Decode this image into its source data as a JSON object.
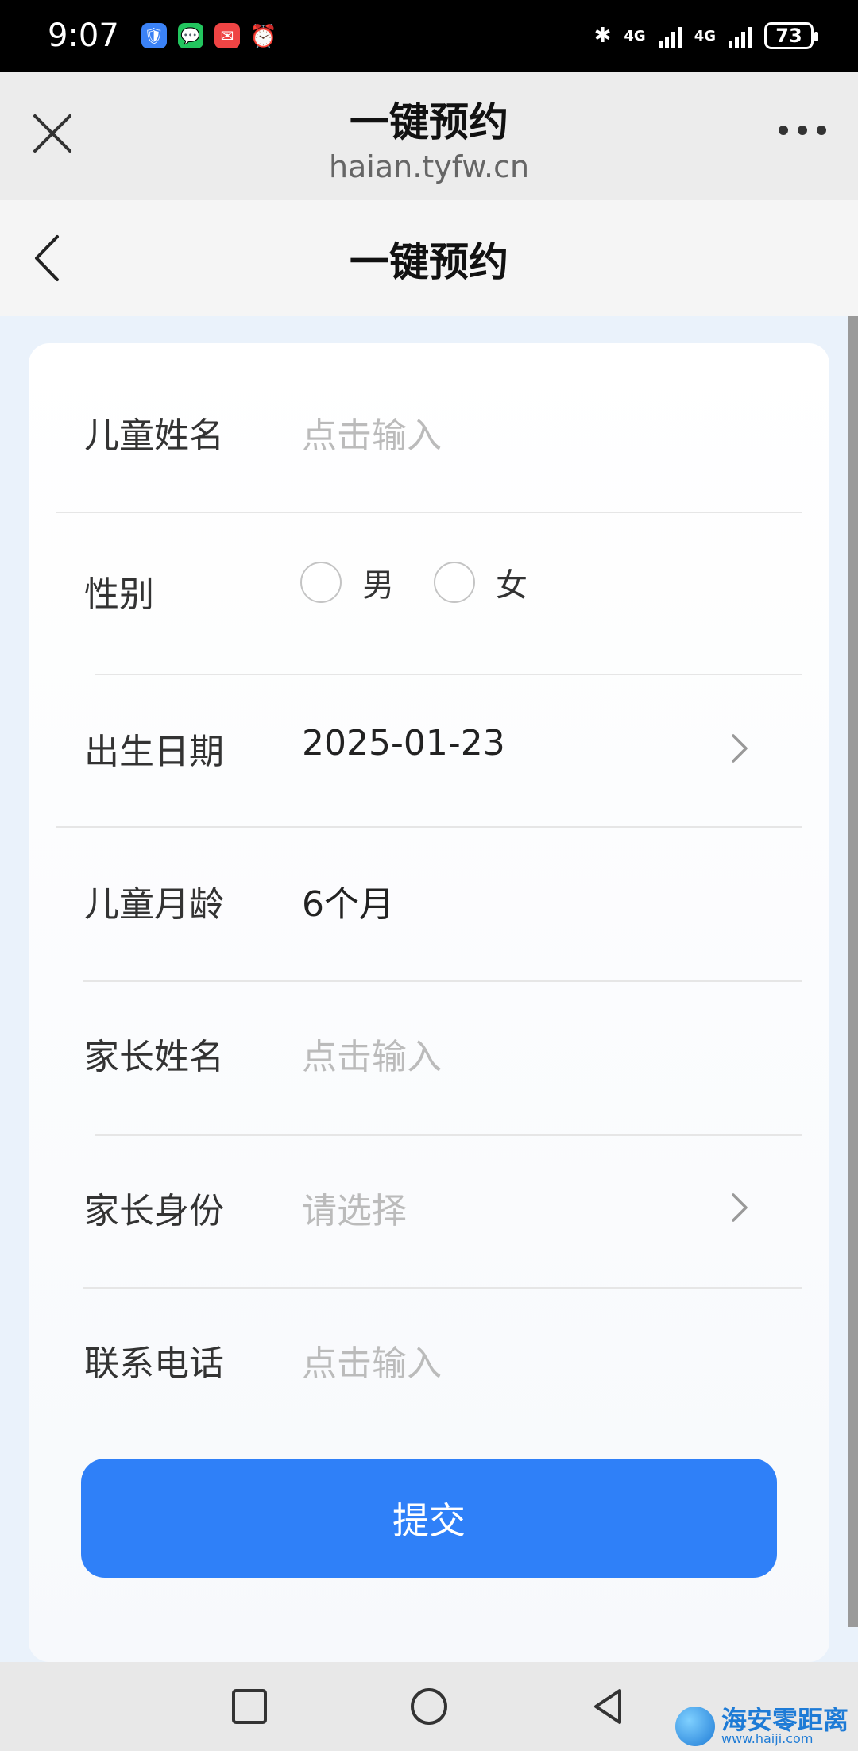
{
  "status_bar": {
    "time": "9:07",
    "network1": "4G",
    "network2": "4G",
    "battery": "73"
  },
  "browser": {
    "title": "一键预约",
    "url": "haian.tyfw.cn"
  },
  "page": {
    "title": "一键预约"
  },
  "form": {
    "child_name": {
      "label": "儿童姓名",
      "placeholder": "点击输入"
    },
    "gender": {
      "label": "性别",
      "options": [
        "男",
        "女"
      ]
    },
    "birth_date": {
      "label": "出生日期",
      "value": "2025-01-23"
    },
    "child_age": {
      "label": "儿童月龄",
      "value": "6个月"
    },
    "parent_name": {
      "label": "家长姓名",
      "placeholder": "点击输入"
    },
    "parent_identity": {
      "label": "家长身份",
      "placeholder": "请选择"
    },
    "phone": {
      "label": "联系电话",
      "placeholder": "点击输入"
    },
    "submit_label": "提交"
  },
  "watermark": {
    "title": "海安零距离",
    "url": "www.haiji.com"
  },
  "colors": {
    "accent": "#2f80f8",
    "page_bg": "#eaf2fb"
  }
}
